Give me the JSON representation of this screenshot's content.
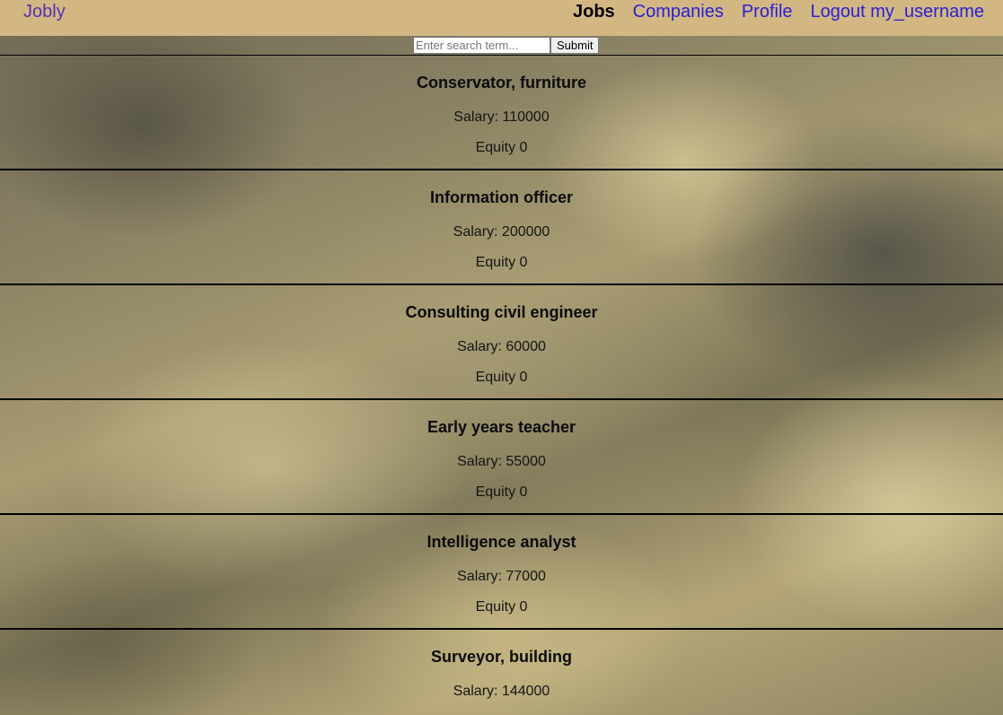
{
  "navbar": {
    "brand": "Jobly",
    "links": [
      {
        "label": "Jobs",
        "active": true
      },
      {
        "label": "Companies",
        "active": false
      },
      {
        "label": "Profile",
        "active": false
      },
      {
        "label": "Logout my_username",
        "active": false
      }
    ]
  },
  "search": {
    "placeholder": "Enter search term...",
    "value": "",
    "submit_label": "Submit"
  },
  "jobs": [
    {
      "title": "Conservator, furniture",
      "salary": "Salary: 110000",
      "equity": "Equity 0"
    },
    {
      "title": "Information officer",
      "salary": "Salary: 200000",
      "equity": "Equity 0"
    },
    {
      "title": "Consulting civil engineer",
      "salary": "Salary: 60000",
      "equity": "Equity 0"
    },
    {
      "title": "Early years teacher",
      "salary": "Salary: 55000",
      "equity": "Equity 0"
    },
    {
      "title": "Intelligence analyst",
      "salary": "Salary: 77000",
      "equity": "Equity 0"
    },
    {
      "title": "Surveyor, building",
      "salary": "Salary: 144000",
      "equity": ""
    }
  ],
  "colors": {
    "navbar_bg": "#d2b783",
    "brand": "#5a2fb0",
    "link": "#2a1fd4",
    "active_link": "#000000"
  }
}
